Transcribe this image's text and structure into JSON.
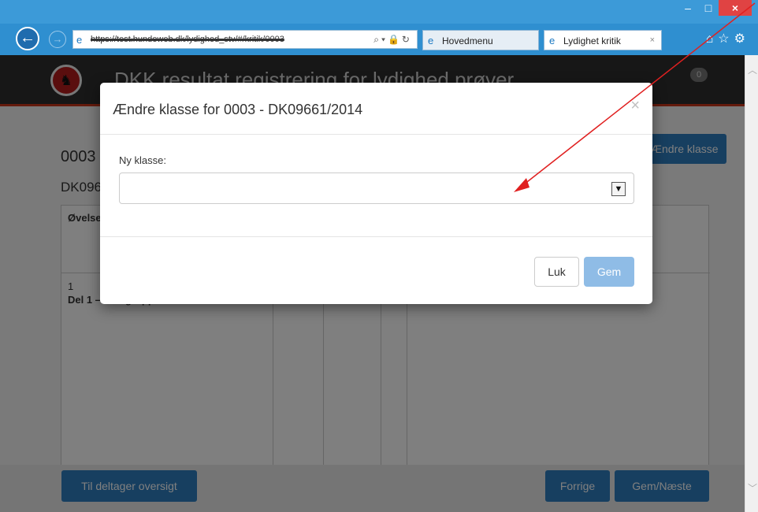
{
  "browser": {
    "address_text": "https://test.hundeweb.dk/lydighed_stv/#/kritik/0003",
    "tabs": [
      {
        "label": "Hovedmenu"
      },
      {
        "label": "Lydighet kritik"
      }
    ],
    "tab_close": "×",
    "icons": [
      "back-arrow-icon",
      "forward-arrow-icon",
      "ie-icon",
      "search-icon",
      "lock-icon",
      "refresh-icon",
      "home-icon",
      "star-icon",
      "gear-icon"
    ]
  },
  "page": {
    "title": "DKK resultat registrering for lydighed prøver",
    "badge": "0",
    "participant_id": "0003",
    "registration": "DK09661/2014",
    "change_class_button": "Ændre klasse",
    "table_header": "Øvelse",
    "row_number": "1",
    "row_label": "Del 1 – Sit i gruppe",
    "btn_overview": "Til deltager oversigt",
    "btn_prev": "Forrige",
    "btn_save_next": "Gem/Næste"
  },
  "modal": {
    "title": "Ændre klasse for 0003 - DK09661/2014",
    "close": "×",
    "field_label": "Ny klasse:",
    "select_value": "",
    "btn_close": "Luk",
    "btn_save": "Gem"
  },
  "colors": {
    "annotation_arrow": "#e02020",
    "primary_button": "#2f7fc1",
    "disabled_button": "#8fbce6"
  }
}
